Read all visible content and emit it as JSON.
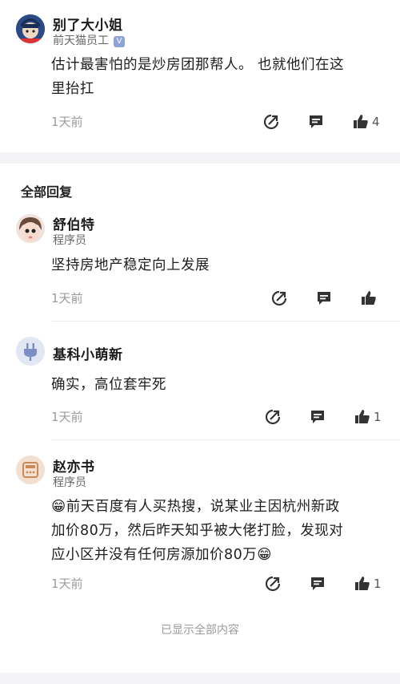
{
  "top_comment": {
    "user": "别了大小姐",
    "role": "前天猫员工",
    "verified_mark": "V",
    "text_line1": "估计最害怕的是炒房团那帮人。 也就他们在这",
    "text_line2": "里抬扛",
    "time": "1天前",
    "likes": "4"
  },
  "section_title": "全部回复",
  "replies": [
    {
      "user": "舒伯特",
      "role": "程序员",
      "lines": [
        "坚持房地产稳定向上发展"
      ],
      "time": "1天前",
      "likes": ""
    },
    {
      "user": "基科小萌新",
      "role": "",
      "lines": [
        "确实，高位套牢死"
      ],
      "time": "1天前",
      "likes": "1"
    },
    {
      "user": "赵亦书",
      "role": "程序员",
      "lines": [
        "😁前天百度有人买热搜，说某业主因杭州新政",
        "加价80万，然后昨天知乎被大佬打脸，发现对",
        "应小区并没有任何房源加价80万😁"
      ],
      "time": "1天前",
      "likes": "1"
    }
  ],
  "footer": "已显示全部内容",
  "icons": {
    "share": "share-icon",
    "comment": "comment-icon",
    "like": "thumbs-up-icon"
  }
}
